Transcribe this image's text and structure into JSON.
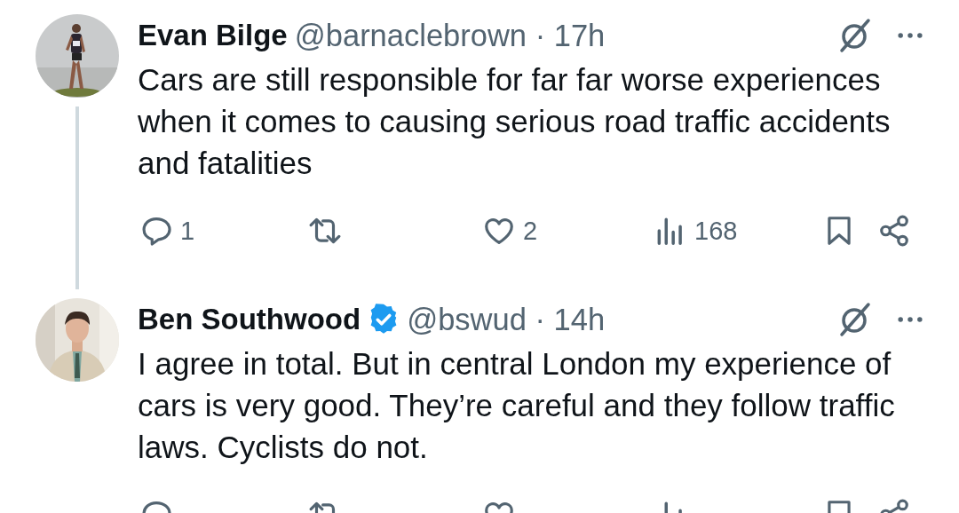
{
  "tweets": [
    {
      "name": "Evan Bilge",
      "meta": "@barnaclebrown · 17h",
      "text": "Cars are still responsible for far far worse experiences when it comes to causing serious road traffic accidents and fatalities",
      "thread_line": true,
      "counts": {
        "replies": "1",
        "likes": "2",
        "views": "168"
      }
    },
    {
      "name": "Ben Southwood",
      "verified": true,
      "meta": "@bswud · 14h",
      "text": "I agree in total. But in central London my experience of cars is very good. They’re careful and they follow traffic laws. Cyclists do not."
    }
  ]
}
